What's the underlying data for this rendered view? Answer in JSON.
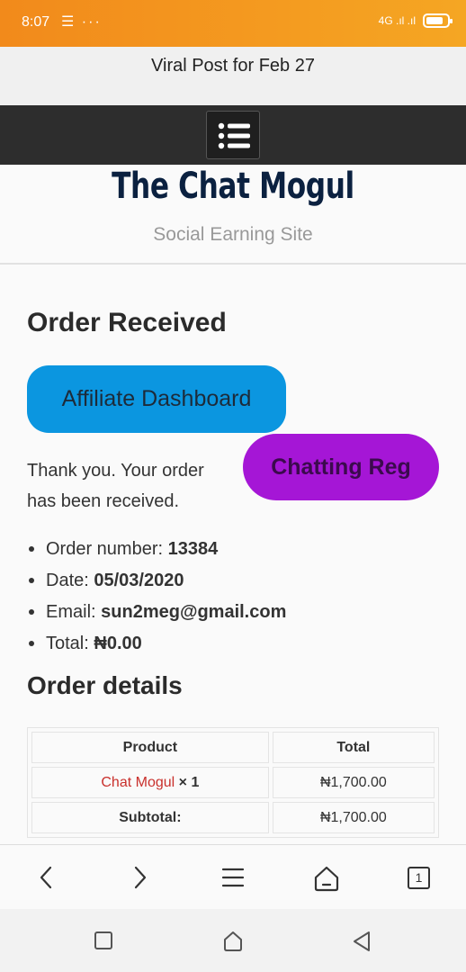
{
  "status_bar": {
    "time": "8:07",
    "left_icons": "☰ ···",
    "signal": "4G .ıl .ıl",
    "battery_level": 0.8
  },
  "banner": {
    "text": "Viral Post for Feb 27"
  },
  "site": {
    "title": "The Chat Mogul",
    "tagline": "Social Earning Site"
  },
  "page": {
    "heading": "Order Received",
    "affiliate_button": "Affiliate Dashboard",
    "chatting_button": "Chatting Reg",
    "thank_you": "Thank you. Your order has been received."
  },
  "order": {
    "number_label": "Order number:",
    "number": "13384",
    "date_label": "Date:",
    "date": "05/03/2020",
    "email_label": "Email:",
    "email": "sun2meg@gmail.com",
    "total_label": "Total:",
    "total": "₦0.00"
  },
  "details": {
    "heading": "Order details",
    "headers": [
      "Product",
      "Total"
    ],
    "product_name": "Chat Mogul",
    "product_qty": "× 1",
    "product_total": "₦1,700.00",
    "subtotal_label": "Subtotal:",
    "subtotal_value": "₦1,700.00"
  },
  "browser": {
    "tab_count": "1"
  },
  "colors": {
    "accent_blue": "#0b96e0",
    "accent_purple": "#a516d6",
    "title_navy": "#0b2140",
    "link_red": "#c9302c"
  }
}
